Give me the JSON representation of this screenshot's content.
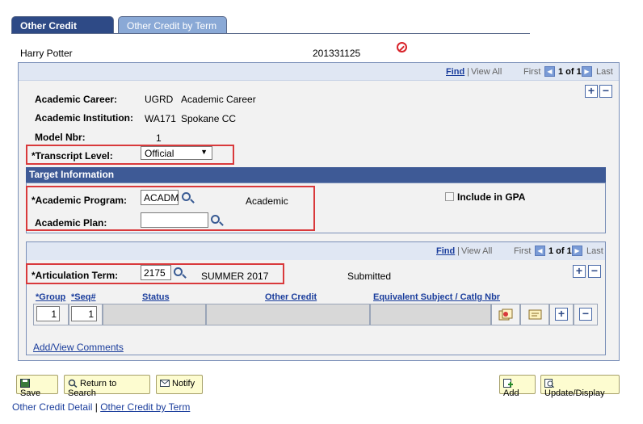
{
  "tabs": [
    {
      "label": "Other Credit Detail"
    },
    {
      "label": "Other Credit by Term"
    }
  ],
  "header": {
    "name": "Harry Potter",
    "id": "201331125"
  },
  "nav": {
    "find": "Find",
    "view_all": "View All",
    "first": "First",
    "count": "1 of 1",
    "last": "Last"
  },
  "career": {
    "career_label": "Academic Career:",
    "career_code": "UGRD",
    "career_desc": "Academic Career",
    "institution_label": "Academic Institution:",
    "institution_code": "WA171",
    "institution_desc": "Spokane CC",
    "model_label": "Model Nbr:",
    "model_value": "1",
    "transcript_label": "*Transcript Level:",
    "transcript_value": "Official"
  },
  "target": {
    "title": "Target Information",
    "program_label": "*Academic Program:",
    "program_value": "ACADM",
    "program_desc": "Academic",
    "plan_label": "Academic Plan:",
    "plan_value": "",
    "gpa_label": "Include in GPA"
  },
  "articulation": {
    "term_label": "*Articulation Term:",
    "term_value": "2175",
    "term_desc": "SUMMER 2017",
    "status": "Submitted"
  },
  "grid": {
    "headers": [
      "*Group",
      "*Seq#",
      "Status",
      "Other Credit",
      "Equivalent Subject / Catlg Nbr"
    ],
    "row": {
      "group": "1",
      "seq": "1"
    }
  },
  "comments_link": "Add/View Comments",
  "buttons": {
    "save": "Save",
    "return": "Return to Search",
    "notify": "Notify",
    "add": "Add",
    "update": "Update/Display"
  },
  "footer": {
    "link1": "Other Credit Detail",
    "sep": "|",
    "link2": "Other Credit by Term"
  }
}
